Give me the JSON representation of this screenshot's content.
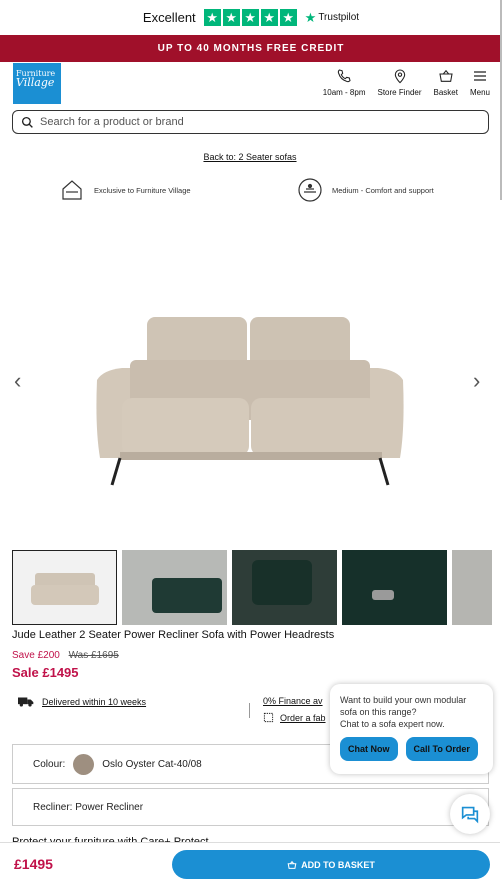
{
  "trustpilot": {
    "label": "Excellent",
    "brand": "Trustpilot",
    "stars": 5
  },
  "promo": {
    "text": "UP TO 40 MONTHS FREE CREDIT"
  },
  "logo": {
    "line1": "Furniture",
    "line2": "Village"
  },
  "nav": [
    {
      "label": "10am - 8pm",
      "icon": "phone-icon"
    },
    {
      "label": "Store Finder",
      "icon": "map-pin-icon"
    },
    {
      "label": "Basket",
      "icon": "basket-icon"
    },
    {
      "label": "Menu",
      "icon": "menu-icon"
    }
  ],
  "search": {
    "placeholder": "Search for a product or brand"
  },
  "back_link": "Back to: 2 Seater sofas",
  "features": [
    {
      "label": "Exclusive to Furniture Village",
      "icon": "house-icon"
    },
    {
      "label": "Medium - Comfort and support",
      "icon": "comfort-icon"
    }
  ],
  "product": {
    "title": "Jude Leather 2 Seater Power Recliner Sofa with Power Headrests",
    "save": "Save £200",
    "was": "Was £1695",
    "sale": "Sale £1495"
  },
  "delivery": {
    "text": "Delivered within 10 weeks"
  },
  "finance": {
    "text": "0% Finance av"
  },
  "fabric": {
    "text": "Order a fab"
  },
  "options": {
    "colour_label": "Colour:",
    "colour_value": "Oslo Oyster Cat-40/08",
    "recliner": "Recliner: Power Recliner"
  },
  "protect": {
    "text": "Protect your furniture with Care+ Protect"
  },
  "chat": {
    "line1": "Want to build your own modular sofa on this range?",
    "line2": "Chat to a sofa expert now.",
    "chat_now": "Chat Now",
    "call": "Call To Order"
  },
  "bottom": {
    "price": "£1495",
    "add_label": "ADD TO BASKET"
  },
  "colors": {
    "brand": "#1b8fd3",
    "promo": "#a0102a",
    "sale": "#c0124a",
    "trustpilot": "#00b67a"
  }
}
